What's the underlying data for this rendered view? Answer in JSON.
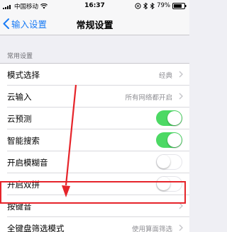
{
  "status_bar": {
    "carrier": "中国移动",
    "time": "16:37",
    "battery": "79%",
    "icons": [
      "signal-icon",
      "wifi-icon",
      "location-icon",
      "alarm-icon",
      "bluetooth-icon",
      "battery-icon"
    ]
  },
  "nav": {
    "back_label": "输入设置",
    "title": "常规设置"
  },
  "section": {
    "header": "常用设置"
  },
  "rows": [
    {
      "label": "模式选择",
      "value": "经典",
      "type": "chevron"
    },
    {
      "label": "云输入",
      "value": "所有网络都开启",
      "type": "chevron"
    },
    {
      "label": "云预测",
      "value": "",
      "type": "toggle",
      "toggle_on": true
    },
    {
      "label": "智能搜索",
      "value": "",
      "type": "toggle",
      "toggle_on": true
    },
    {
      "label": "开启模糊音",
      "value": "",
      "type": "toggle",
      "toggle_on": false
    },
    {
      "label": "开启双拼",
      "value": "",
      "type": "toggle",
      "toggle_on": false
    },
    {
      "label": "按键音",
      "value": "",
      "type": "chevron"
    },
    {
      "label": "全键盘筛选模式",
      "value": "使用算面筛选",
      "type": "chevron"
    }
  ],
  "colors": {
    "accent": "#1a7cf5",
    "toggle_on": "#4cd964",
    "annotation": "#e6242a",
    "background": "#efeff4"
  }
}
